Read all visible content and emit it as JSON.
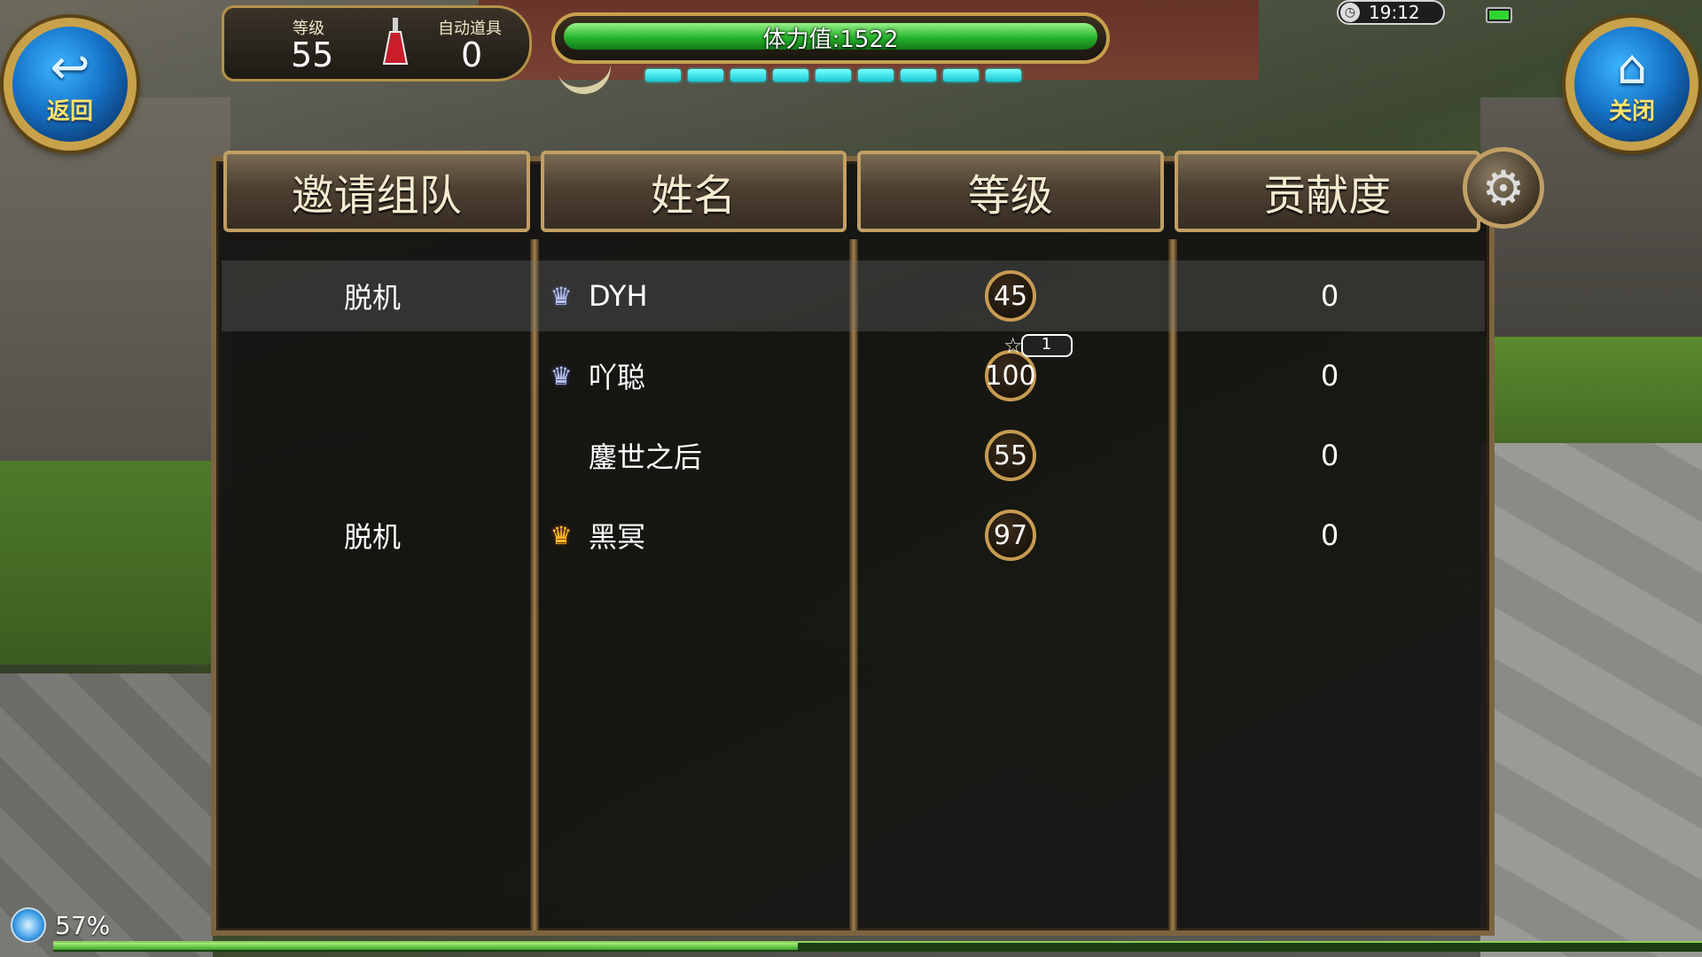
{
  "hud": {
    "back_label": "返回",
    "close_label": "关闭",
    "level_caption": "等级",
    "level_value": "55",
    "auto_item_caption": "自动道具",
    "auto_item_value": "0",
    "stamina_text": "体力值:1522",
    "time": "19:12",
    "exp_percent": "57%"
  },
  "table": {
    "headers": [
      "邀请组队",
      "姓名",
      "等级",
      "贡献度"
    ],
    "rows": [
      {
        "status": "脱机",
        "crown": "silver",
        "name": "DYH",
        "level": "45",
        "contribution": "0"
      },
      {
        "status": "",
        "crown": "silver",
        "name": "吖聪",
        "level": "100",
        "contribution": "0",
        "star_count": "1"
      },
      {
        "status": "",
        "crown": "none",
        "name": "鏖世之后",
        "level": "55",
        "contribution": "0"
      },
      {
        "status": "脱机",
        "crown": "gold",
        "name": "黑冥",
        "level": "97",
        "contribution": "0"
      }
    ]
  },
  "colors": {
    "stamina": "#25b42a",
    "frame_gold": "#c19f64",
    "button_blue": "#1674c9"
  }
}
